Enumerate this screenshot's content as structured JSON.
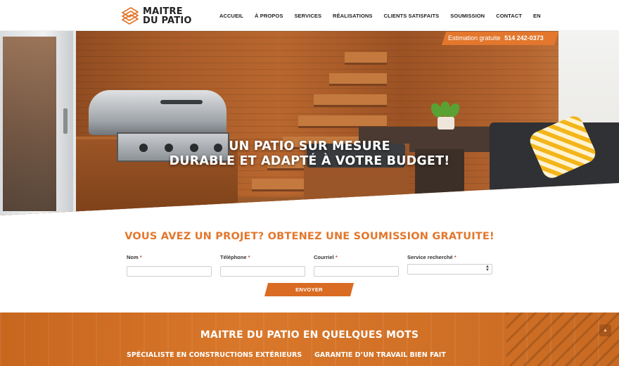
{
  "brand": {
    "line1": "MAITRE",
    "line2": "DU PATIO",
    "accent_color": "#e2772d"
  },
  "nav": {
    "items": [
      {
        "label": "ACCUEIL"
      },
      {
        "label": "À PROPOS"
      },
      {
        "label": "SERVICES"
      },
      {
        "label": "RÉALISATIONS"
      },
      {
        "label": "CLIENTS SATISFAITS"
      },
      {
        "label": "SOUMISSION"
      },
      {
        "label": "CONTACT"
      },
      {
        "label": "EN"
      }
    ]
  },
  "promo": {
    "label": "Estimation gratuite",
    "phone": "514 242-0373"
  },
  "hero": {
    "line1": "UN PATIO SUR MESURE",
    "line2": "DURABLE ET ADAPTÉ À VOTRE BUDGET!"
  },
  "quote_form": {
    "heading": "VOUS AVEZ UN PROJET? OBTENEZ UNE SOUMISSION GRATUITE!",
    "fields": [
      {
        "label": "Nom",
        "required_mark": "*",
        "value": ""
      },
      {
        "label": "Téléphone",
        "required_mark": "*",
        "value": ""
      },
      {
        "label": "Courriel",
        "required_mark": "*",
        "value": ""
      },
      {
        "label": "Service recherché",
        "required_mark": "*",
        "value": ""
      }
    ],
    "submit_label": "ENVOYER"
  },
  "about": {
    "title": "MAITRE DU PATIO EN QUELQUES MOTS",
    "col1_title": "SPÉCIALISTE EN CONSTRUCTIONS EXTÉRIEURS",
    "col2_title": "GARANTIE D’UN TRAVAIL BIEN FAIT"
  },
  "icons": {
    "logo": "stacked-planks-icon",
    "select_arrows": "up-down-arrows-icon",
    "scroll_top": "chevron-up-icon"
  }
}
